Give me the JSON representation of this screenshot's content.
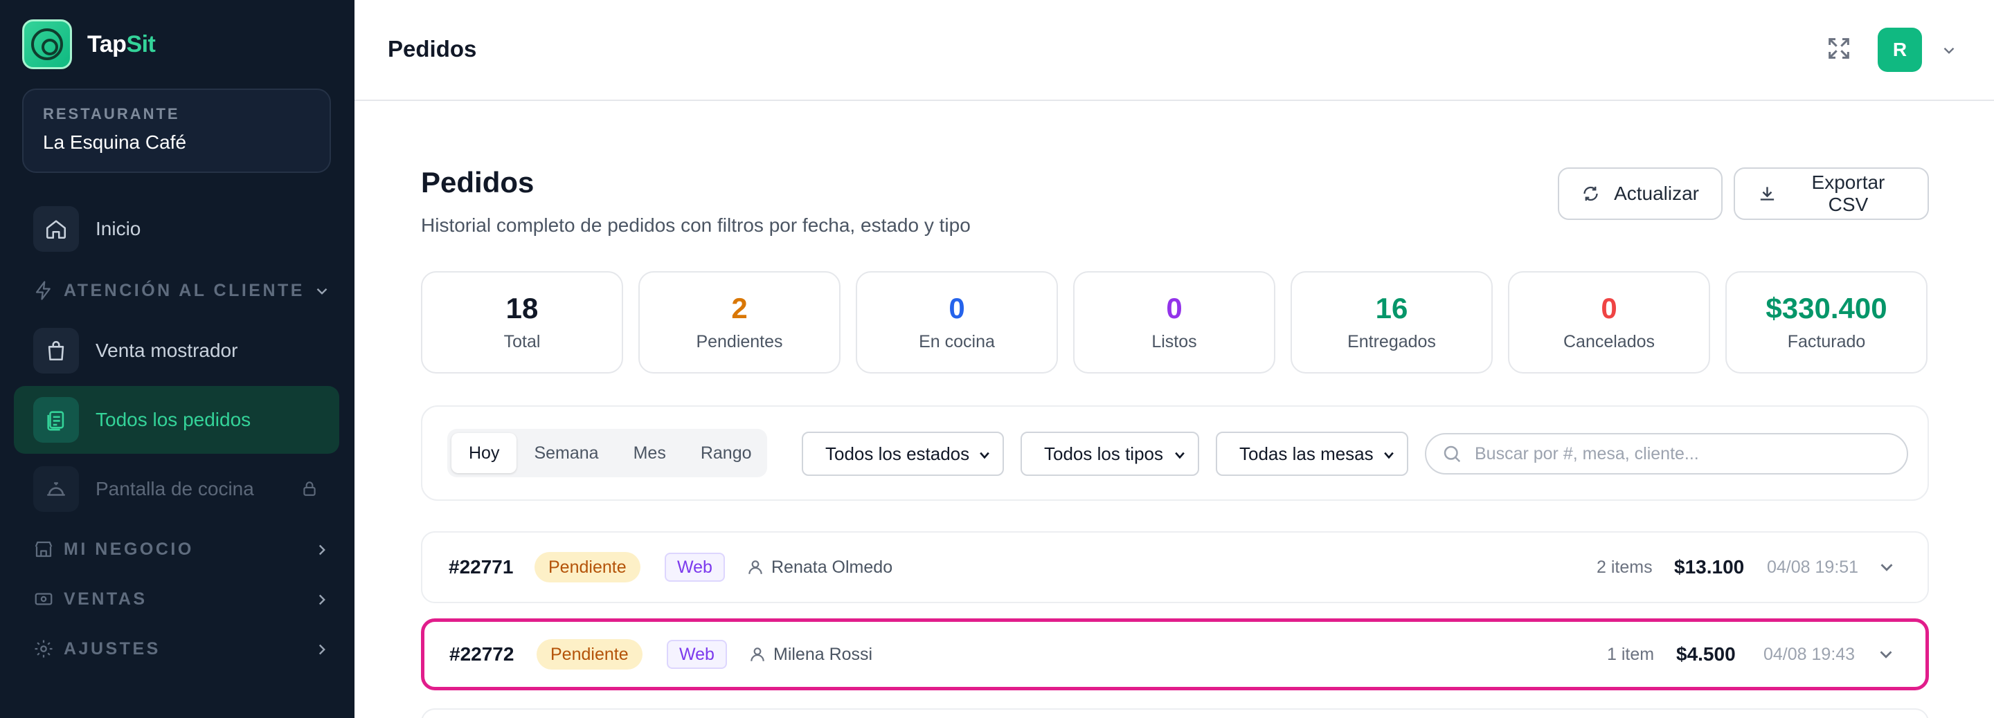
{
  "sidebar": {
    "brand": {
      "part1": "Tap",
      "part2": "Sit"
    },
    "restaurant": {
      "label": "RESTAURANTE",
      "name": "La Esquina Café"
    },
    "items": [
      {
        "label": "Inicio",
        "icon": "home-icon"
      },
      {
        "label": "Venta mostrador",
        "icon": "shopping-bag-icon"
      },
      {
        "label": "Todos los pedidos",
        "icon": "orders-icon",
        "active": true
      },
      {
        "label": "Pantalla de cocina",
        "icon": "cloche-icon",
        "locked": true
      }
    ],
    "sections": [
      {
        "label": "ATENCIÓN AL CLIENTE",
        "icon": "bolt-icon",
        "expanded": true
      },
      {
        "label": "MI NEGOCIO",
        "icon": "store-icon",
        "expanded": false
      },
      {
        "label": "VENTAS",
        "icon": "cash-icon",
        "expanded": false
      },
      {
        "label": "AJUSTES",
        "icon": "gear-icon",
        "expanded": false
      }
    ]
  },
  "header": {
    "title": "Pedidos",
    "avatar_initial": "R"
  },
  "main": {
    "title": "Pedidos",
    "subtitle": "Historial completo de pedidos con filtros por fecha, estado y tipo",
    "refresh_label": "Actualizar",
    "export_label": "Exportar CSV"
  },
  "stats": [
    {
      "value": "18",
      "label": "Total",
      "color": "#111827"
    },
    {
      "value": "2",
      "label": "Pendientes",
      "color": "#d97706"
    },
    {
      "value": "0",
      "label": "En cocina",
      "color": "#2563eb"
    },
    {
      "value": "0",
      "label": "Listos",
      "color": "#9333ea"
    },
    {
      "value": "16",
      "label": "Entregados",
      "color": "#059669"
    },
    {
      "value": "0",
      "label": "Cancelados",
      "color": "#ef4444"
    },
    {
      "value": "$330.400",
      "label": "Facturado",
      "color": "#059669"
    }
  ],
  "filters": {
    "periods": [
      "Hoy",
      "Semana",
      "Mes",
      "Rango"
    ],
    "active_period": "Hoy",
    "status_select": "Todos los estados",
    "type_select": "Todos los tipos",
    "table_select": "Todas las mesas",
    "search_placeholder": "Buscar por #, mesa, cliente..."
  },
  "orders": [
    {
      "id": "#22771",
      "status": "Pendiente",
      "channel": "Web",
      "customer": "Renata Olmedo",
      "items": "2 items",
      "total": "$13.100",
      "date": "04/08 19:51"
    },
    {
      "id": "#22772",
      "status": "Pendiente",
      "channel": "Web",
      "customer": "Milena Rossi",
      "items": "1 item",
      "total": "$4.500",
      "date": "04/08 19:43"
    }
  ],
  "colors": {
    "accent": "#10b981",
    "sidebar_bg": "#0f1a29",
    "highlight": "#e11d8b"
  }
}
